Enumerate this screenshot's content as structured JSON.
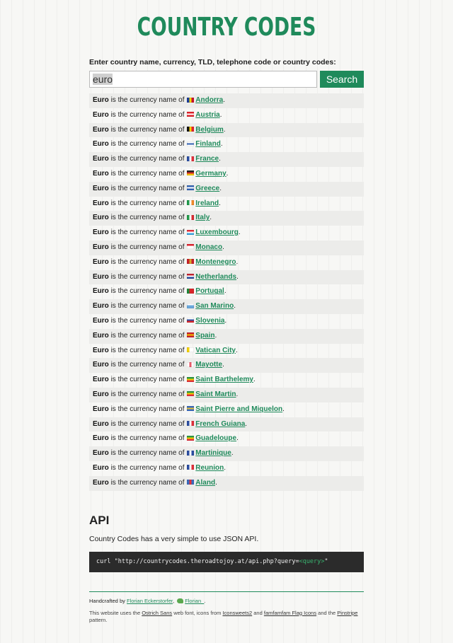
{
  "header": {
    "title": "COUNTRY CODES"
  },
  "search": {
    "label": "Enter country name, currency, TLD, telephone code or country codes:",
    "value": "euro",
    "button": "Search"
  },
  "results": {
    "currency": "Euro",
    "phrase": "is the currency name of",
    "items": [
      {
        "country": "Andorra",
        "flag": [
          "#1a3d9c",
          "#f2d700",
          "#c8102e"
        ]
      },
      {
        "country": "Austria",
        "flag": [
          "#e0232b",
          "#ffffff",
          "#e0232b"
        ],
        "h": true
      },
      {
        "country": "Belgium",
        "flag": [
          "#111111",
          "#f4d000",
          "#e4222b"
        ]
      },
      {
        "country": "Finland",
        "flag": [
          "#ffffff",
          "#2f5fb0",
          "#ffffff"
        ],
        "h": true
      },
      {
        "country": "France",
        "flag": [
          "#2b4ea2",
          "#ffffff",
          "#e0303a"
        ]
      },
      {
        "country": "Germany",
        "flag": [
          "#222222",
          "#d8262a",
          "#f4c400"
        ],
        "h": true
      },
      {
        "country": "Greece",
        "flag": [
          "#3466b4",
          "#ffffff",
          "#3466b4"
        ],
        "h": true
      },
      {
        "country": "Ireland",
        "flag": [
          "#219b4c",
          "#ffffff",
          "#f28a2a"
        ]
      },
      {
        "country": "Italy",
        "flag": [
          "#229c4a",
          "#ffffff",
          "#d92b32"
        ]
      },
      {
        "country": "Luxembourg",
        "flag": [
          "#e3303a",
          "#ffffff",
          "#3aa6df"
        ],
        "h": true
      },
      {
        "country": "Monaco",
        "flag": [
          "#e0242f",
          "#ffffff",
          "#ffffff"
        ],
        "h": true
      },
      {
        "country": "Montenegro",
        "flag": [
          "#c8202a",
          "#d6a62a",
          "#c8202a"
        ]
      },
      {
        "country": "Netherlands",
        "flag": [
          "#c42330",
          "#ffffff",
          "#244b9c"
        ],
        "h": true
      },
      {
        "country": "Portugal",
        "flag": [
          "#1f8a3a",
          "#d8262a",
          "#d8262a"
        ]
      },
      {
        "country": "San Marino",
        "flag": [
          "#ffffff",
          "#6aa8dc",
          "#6aa8dc"
        ],
        "h": true
      },
      {
        "country": "Slovenia",
        "flag": [
          "#ffffff",
          "#2b4ea2",
          "#d8262a"
        ],
        "h": true
      },
      {
        "country": "Spain",
        "flag": [
          "#c9232b",
          "#f3c200",
          "#c9232b"
        ],
        "h": true
      },
      {
        "country": "Vatican City",
        "flag": [
          "#f4d200",
          "#ffffff",
          "#ffffff"
        ]
      },
      {
        "country": "Mayotte",
        "flag": [
          "#ffffff",
          "#e85a6a",
          "#ffffff"
        ]
      },
      {
        "country": "Saint Barthelemy",
        "flag": [
          "#2e9a44",
          "#f4d000",
          "#e3303a"
        ],
        "h": true
      },
      {
        "country": "Saint Martin",
        "flag": [
          "#2e9a44",
          "#f4d000",
          "#e3303a"
        ],
        "h": true
      },
      {
        "country": "Saint Pierre and Miquelon",
        "flag": [
          "#3a6bbf",
          "#e8c23a",
          "#3a6bbf"
        ],
        "h": true
      },
      {
        "country": "French Guiana",
        "flag": [
          "#2b4ea2",
          "#ffffff",
          "#e0303a"
        ]
      },
      {
        "country": "Guadeloupe",
        "flag": [
          "#2e9a44",
          "#f4d000",
          "#e3303a"
        ],
        "h": true
      },
      {
        "country": "Martinique",
        "flag": [
          "#2b4ea2",
          "#ffffff",
          "#2b4ea2"
        ]
      },
      {
        "country": "Reunion",
        "flag": [
          "#2b4ea2",
          "#ffffff",
          "#e0303a"
        ]
      },
      {
        "country": "Aland",
        "flag": [
          "#3a6bbf",
          "#e3303a",
          "#3a6bbf"
        ]
      }
    ]
  },
  "api": {
    "heading": "API",
    "description": "Country Codes has a very simple to use JSON API.",
    "code_prefix": "curl \"http://countrycodes.theroadtojoy.at/api.php?query=",
    "code_placeholder": "<query>",
    "code_suffix": "\""
  },
  "footer": {
    "handcrafted": "Handcrafted by",
    "author": "Florian Eckerstorfer",
    "comma": ",",
    "twitter": "Florian_",
    "period": ".",
    "line2_a": "This website uses the",
    "font_link": "Ostrich Sans",
    "line2_b": "web font, icons from",
    "icons_link": "Iconsweets2",
    "and1": "and",
    "flags_link": "famfamfam Flag Icons",
    "and2": "and the",
    "pattern_link": "Pinstripe",
    "line2_c": "pattern.",
    "brand_color": "#1f8a5b"
  }
}
